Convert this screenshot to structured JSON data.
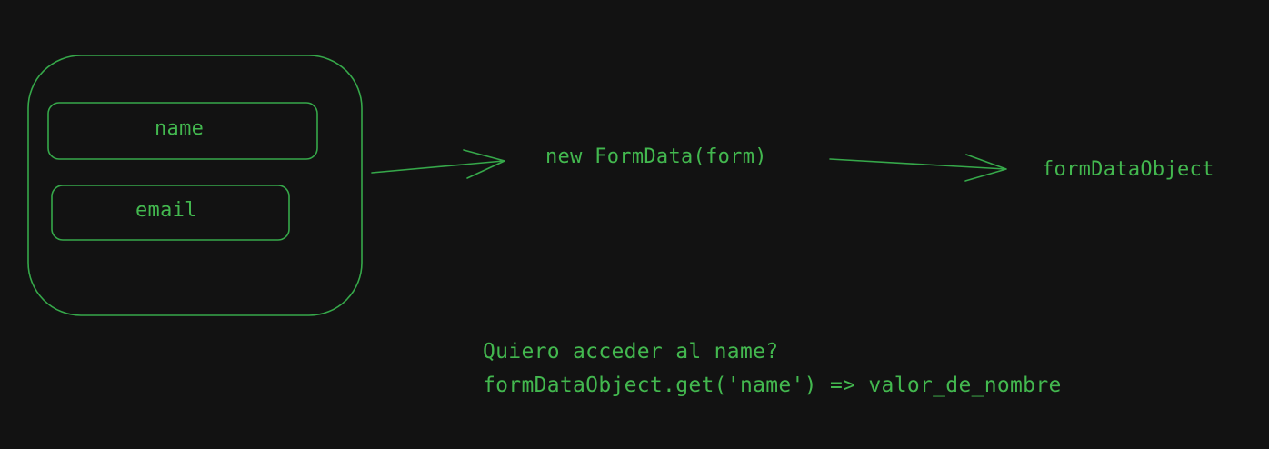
{
  "diagram": {
    "form_fields": {
      "name_label": "name",
      "email_label": "email"
    },
    "constructor_text": "new FormData(form)",
    "result_text": "formDataObject",
    "note": {
      "question": "Quiero acceder al name?",
      "code": "formDataObject.get('name') => valor_de_nombre"
    },
    "colors": {
      "background": "#121212",
      "stroke": "#36a84a",
      "text": "#43b84f"
    }
  }
}
